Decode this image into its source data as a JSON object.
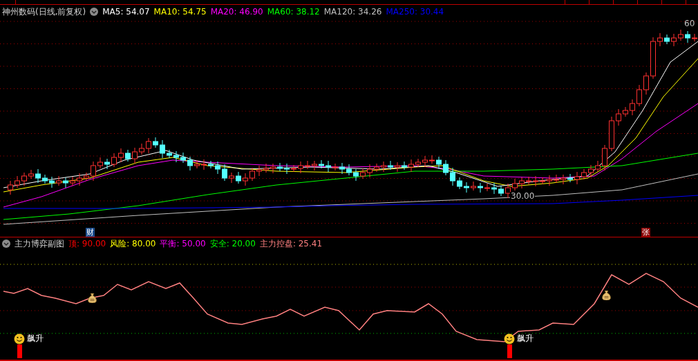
{
  "title": "神州数码(日线,前复权)",
  "indicators": [
    {
      "label": "MA5: 54.07",
      "color": "#ffffff"
    },
    {
      "label": "MA10: 54.75",
      "color": "#ffff00"
    },
    {
      "label": "MA20: 46.90",
      "color": "#ff00ff"
    },
    {
      "label": "MA60: 38.12",
      "color": "#00ff00"
    },
    {
      "label": "MA120: 34.26",
      "color": "#c0c0c0"
    },
    {
      "label": "MA250: 30.44",
      "color": "#0000ff"
    }
  ],
  "price_marks": [
    {
      "text": "60",
      "kind": "high"
    },
    {
      "text": "30.00",
      "kind": "low"
    }
  ],
  "event_tags": [
    {
      "text": "财",
      "color": "#1c4d8c"
    },
    {
      "text": "张",
      "color": "#8b0000"
    }
  ],
  "sub_panel": {
    "title": "主力博弈副图",
    "indicators": [
      {
        "label": "顶: 90.00",
        "color": "#ff0000"
      },
      {
        "label": "风险: 80.00",
        "color": "#ffff00"
      },
      {
        "label": "平衡: 50.00",
        "color": "#ff00ff"
      },
      {
        "label": "安全: 20.00",
        "color": "#00ff00"
      },
      {
        "label": "主力控盘: 25.41",
        "color": "#ff8080"
      }
    ]
  },
  "signals": [
    {
      "text": "飙升"
    },
    {
      "text": "飙升"
    }
  ]
}
